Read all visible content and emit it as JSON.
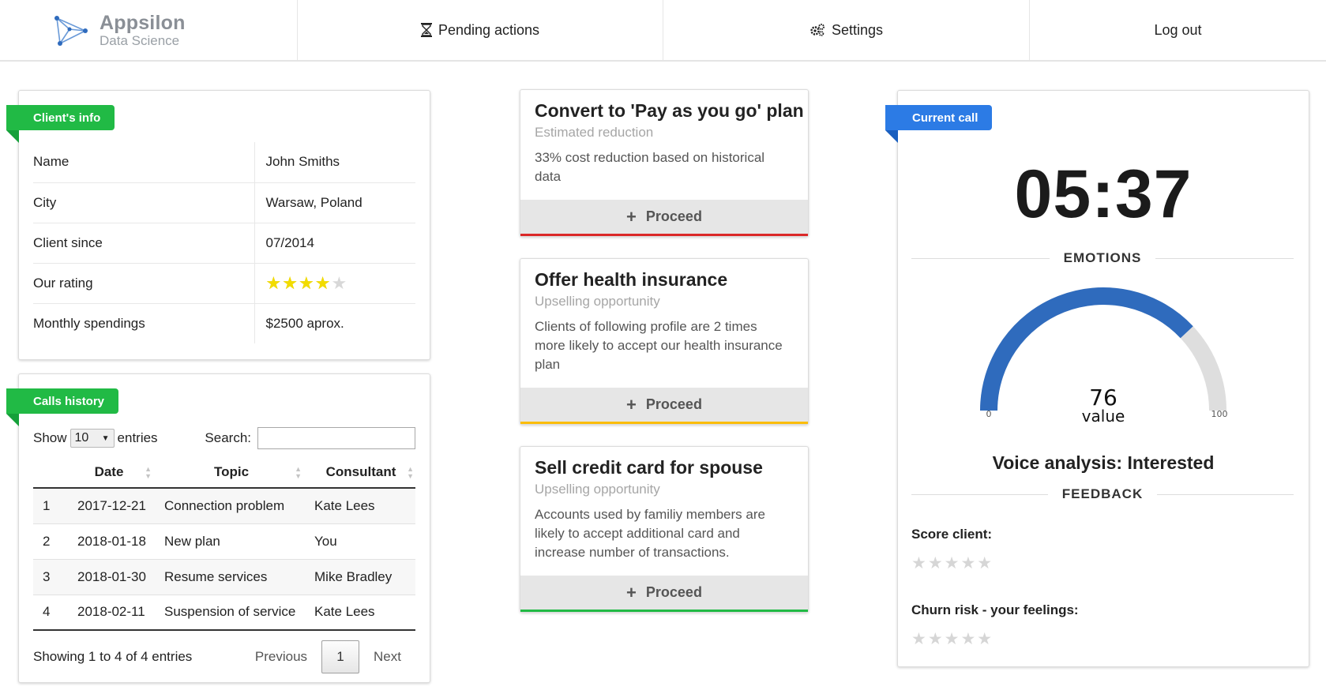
{
  "nav": {
    "logo_title": "Appsilon",
    "logo_subtitle": "Data Science",
    "pending_label": "Pending actions",
    "settings_label": "Settings",
    "logout_label": "Log out"
  },
  "client_info": {
    "ribbon": "Client's info",
    "rows": [
      {
        "key": "Name",
        "value": "John Smiths"
      },
      {
        "key": "City",
        "value": "Warsaw, Poland"
      },
      {
        "key": "Client since",
        "value": "07/2014"
      },
      {
        "key": "Our rating",
        "value": ""
      },
      {
        "key": "Monthly spendings",
        "value": "$2500 aprox."
      }
    ],
    "rating_value": 4,
    "rating_max": 5
  },
  "calls_history": {
    "ribbon": "Calls history",
    "show_label": "Show",
    "page_size": "10",
    "entries_label": "entries",
    "search_label": "Search:",
    "search_value": "",
    "columns": [
      "",
      "Date",
      "Topic",
      "Consultant"
    ],
    "rows": [
      {
        "n": "1",
        "date": "2017-12-21",
        "topic": "Connection problem",
        "consultant": "Kate Lees"
      },
      {
        "n": "2",
        "date": "2018-01-18",
        "topic": "New plan",
        "consultant": "You"
      },
      {
        "n": "3",
        "date": "2018-01-30",
        "topic": "Resume services",
        "consultant": "Mike Bradley"
      },
      {
        "n": "4",
        "date": "2018-02-11",
        "topic": "Suspension of service",
        "consultant": "Kate Lees"
      }
    ],
    "info": "Showing 1 to 4 of 4 entries",
    "previous_label": "Previous",
    "current_page": "1",
    "next_label": "Next"
  },
  "actions": [
    {
      "title": "Convert to 'Pay as you go' plan",
      "subtitle": "Estimated reduction",
      "description": "33% cost reduction based on historical data",
      "button": "Proceed",
      "accent": "#db2828"
    },
    {
      "title": "Offer health insurance",
      "subtitle": "Upselling opportunity",
      "description": "Clients of following profile are 2 times more likely to accept our health insurance plan",
      "button": "Proceed",
      "accent": "#fbbd08"
    },
    {
      "title": "Sell credit card for spouse",
      "subtitle": "Upselling opportunity",
      "description": "Accounts used by familiy members are likely to accept additional card and increase number of transactions.",
      "button": "Proceed",
      "accent": "#21ba45"
    }
  ],
  "current_call": {
    "ribbon": "Current call",
    "timer": "05:37",
    "emotions_heading": "EMOTIONS",
    "gauge": {
      "value": 76,
      "value_label": "value",
      "min": 0,
      "max": 100,
      "min_label": "0",
      "max_label": "100",
      "color": "#2f6bbd",
      "track": "#dedede"
    },
    "voice_analysis": "Voice analysis: Interested",
    "feedback_heading": "FEEDBACK",
    "score_label": "Score client:",
    "score_stars": "★★★★★",
    "churn_label": "Churn risk - your feelings:",
    "churn_stars": "★★★★★"
  }
}
